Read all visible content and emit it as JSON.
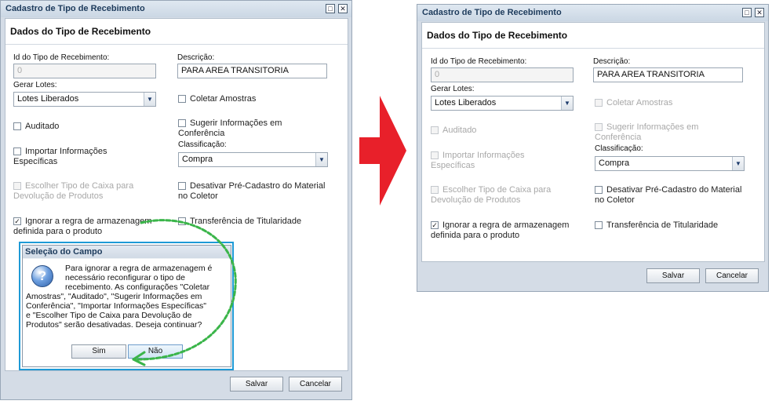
{
  "left_window": {
    "title": "Cadastro de Tipo de Recebimento",
    "panel_title": "Dados do Tipo de Recebimento",
    "fields": {
      "id_label": "Id do Tipo de Recebimento:",
      "id_placeholder": "0",
      "descricao_label": "Descrição:",
      "descricao_value": "PARA AREA TRANSITORIA",
      "gerar_lotes_label": "Gerar Lotes:",
      "gerar_lotes_value": "Lotes Liberados",
      "classificacao_label": "Classificação:",
      "classificacao_value": "Compra"
    },
    "checkboxes": {
      "coletar": "Coletar Amostras",
      "auditado": "Auditado",
      "sugerir_1": "Sugerir Informações em",
      "sugerir_2": "Conferência",
      "importar_1": "Importar Informações",
      "importar_2": "Específicas",
      "escolher_1": "Escolher Tipo de Caixa para",
      "escolher_2": "Devolução de Produtos",
      "desativar_1": "Desativar Pré-Cadastro do Material",
      "desativar_2": "no Coletor",
      "ignorar_1": "Ignorar a regra de armazenagem",
      "ignorar_2": "definida para o produto",
      "transferencia": "Transferência de Titularidade"
    },
    "buttons": {
      "salvar": "Salvar",
      "cancelar": "Cancelar"
    },
    "dialog": {
      "title": "Seleção do Campo",
      "lines": [
        "Para ignorar a regra de armazenagem é",
        "necessário reconfigurar o tipo de",
        "recebimento. As configurações \"Coletar",
        "Amostras\", \"Auditado\", \"Sugerir Informações em",
        "Conferência\", \"Importar Informações Específicas\"",
        "e \"Escolher Tipo de Caixa para Devolução de",
        "Produtos\" serão desativadas. Deseja continuar?"
      ],
      "sim": "Sim",
      "nao": "Não"
    }
  },
  "right_window": {
    "title": "Cadastro de Tipo de Recebimento",
    "panel_title": "Dados do Tipo de Recebimento",
    "fields": {
      "id_label": "Id do Tipo de Recebimento:",
      "id_placeholder": "0",
      "descricao_label": "Descrição:",
      "descricao_value": "PARA AREA TRANSITORIA",
      "gerar_lotes_label": "Gerar Lotes:",
      "gerar_lotes_value": "Lotes Liberados",
      "classificacao_label": "Classificação:",
      "classificacao_value": "Compra"
    },
    "checkboxes": {
      "coletar": "Coletar Amostras",
      "auditado": "Auditado",
      "sugerir_1": "Sugerir Informações em",
      "sugerir_2": "Conferência",
      "importar_1": "Importar Informações",
      "importar_2": "Específicas",
      "escolher_1": "Escolher Tipo de Caixa para",
      "escolher_2": "Devolução de Produtos",
      "desativar_1": "Desativar Pré-Cadastro do Material",
      "desativar_2": "no Coletor",
      "ignorar_1": "Ignorar a regra de armazenagem",
      "ignorar_2": "definida para o produto",
      "transferencia": "Transferência de Titularidade"
    },
    "buttons": {
      "salvar": "Salvar",
      "cancelar": "Cancelar"
    }
  },
  "icons": {
    "maximize": "maximize-icon",
    "close": "close-icon",
    "dropdown": "chevron-down-icon",
    "question": "question-icon",
    "arrow": "right-arrow-icon"
  },
  "colors": {
    "highlight": "#1e9ad6",
    "arrow": "#e8202a",
    "annotation": "#3bb54a"
  }
}
